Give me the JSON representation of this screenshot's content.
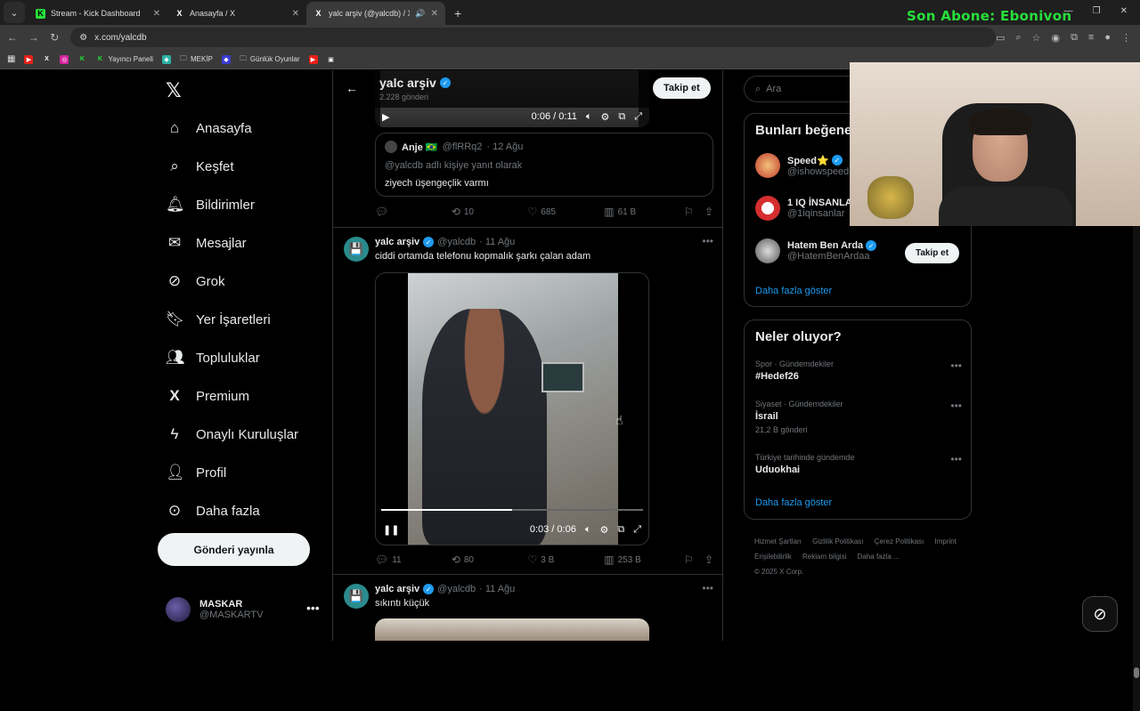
{
  "browser": {
    "tabs": [
      {
        "title": "Stream - Kick Dashboard",
        "favicon": "K",
        "active": false
      },
      {
        "title": "Anasayfa / X",
        "favicon": "X",
        "active": false
      },
      {
        "title": "yalc arşiv (@yalcdb) / X",
        "favicon": "X",
        "active": true
      }
    ],
    "url": "x.com/yalcdb",
    "bookmarks": [
      {
        "label": "",
        "icon": "youtube-icon"
      },
      {
        "label": "",
        "icon": "x-icon"
      },
      {
        "label": "",
        "icon": "instagram-icon"
      },
      {
        "label": "",
        "icon": "kick-icon"
      },
      {
        "label": "Yayıncı Paneli",
        "icon": "kick-icon"
      },
      {
        "label": "",
        "icon": "app-icon"
      },
      {
        "label": "MEKİP",
        "icon": "folder-icon"
      },
      {
        "label": "",
        "icon": "app-icon"
      },
      {
        "label": "Günlük Oyunlar",
        "icon": "folder-icon"
      },
      {
        "label": "",
        "icon": "youtube-icon"
      },
      {
        "label": "",
        "icon": "app-icon"
      }
    ]
  },
  "overlay": {
    "subscriber_banner": "Son Abone: Ebonivon"
  },
  "nav": {
    "items": [
      {
        "label": "Anasayfa",
        "icon": "home-icon"
      },
      {
        "label": "Keşfet",
        "icon": "search-icon"
      },
      {
        "label": "Bildirimler",
        "icon": "bell-icon"
      },
      {
        "label": "Mesajlar",
        "icon": "mail-icon"
      },
      {
        "label": "Grok",
        "icon": "grok-icon"
      },
      {
        "label": "Yer İşaretleri",
        "icon": "bookmark-icon"
      },
      {
        "label": "Topluluklar",
        "icon": "communities-icon"
      },
      {
        "label": "Premium",
        "icon": "x-icon"
      },
      {
        "label": "Onaylı Kuruluşlar",
        "icon": "lightning-icon"
      },
      {
        "label": "Profil",
        "icon": "person-icon"
      },
      {
        "label": "Daha fazla",
        "icon": "more-circle-icon"
      }
    ],
    "post_button": "Gönderi yayınla",
    "account": {
      "name": "MASKAR",
      "handle": "@MASKARTV"
    }
  },
  "profile_header": {
    "name": "yalc arşiv",
    "post_count": "2.228 gönderi",
    "follow_label": "Takip et"
  },
  "top_video": {
    "time": "0:06 / 0:11"
  },
  "quote": {
    "name": "Anje 🇧🇷",
    "handle": "@flRRq2",
    "date": "· 12 Ağu",
    "reply_to": "@yalcdb adlı kişiye yanıt olarak",
    "text": "ziyech üşengeçlik varmı"
  },
  "top_actions": {
    "replies": "",
    "reposts": "10",
    "likes": "685",
    "views": "61 B"
  },
  "tweets": [
    {
      "name": "yalc arşiv",
      "handle": "@yalcdb",
      "date": "· 11 Ağu",
      "text": "ciddi ortamda telefonu kopmalık şarkı çalan adam",
      "video_time": "0:03 / 0:06",
      "video_progress": 0.5,
      "replies": "11",
      "reposts": "80",
      "likes": "3 B",
      "views": "253 B"
    },
    {
      "name": "yalc arşiv",
      "handle": "@yalcdb",
      "date": "· 11 Ağu",
      "text": "sıkıntı küçük"
    }
  ],
  "sidebar": {
    "search_placeholder": "Ara",
    "who_to_follow": {
      "title": "Bunları beğene",
      "users": [
        {
          "name": "Speed⭐",
          "handle": "@ishowspeed",
          "color": "#c0392b"
        },
        {
          "name": "1 IQ İNSANLA",
          "handle": "@1iqinsanlar",
          "color": "#d62e2e"
        },
        {
          "name": "Hatem Ben Arda",
          "handle": "@HatemBenArdaa",
          "color": "#5a5a5a"
        }
      ],
      "follow_label": "Takip et",
      "show_more": "Daha fazla göster"
    },
    "trends": {
      "title": "Neler oluyor?",
      "items": [
        {
          "category": "Spor · Gündemdekiler",
          "name": "#Hedef26",
          "count": ""
        },
        {
          "category": "Siyaset · Gündemdekiler",
          "name": "İsrail",
          "count": "21,2 B gönderi"
        },
        {
          "category": "Türkiye tarihinde gündemde",
          "name": "Uduokhai",
          "count": ""
        }
      ],
      "show_more": "Daha fazla göster"
    },
    "footer": [
      "Hizmet Şartları",
      "Gizlilik Politikası",
      "Çerez Politikası",
      "Imprint",
      "Erişilebilirlik",
      "Reklam bilgisi",
      "Daha fazla ...",
      "© 2025 X Corp."
    ]
  }
}
